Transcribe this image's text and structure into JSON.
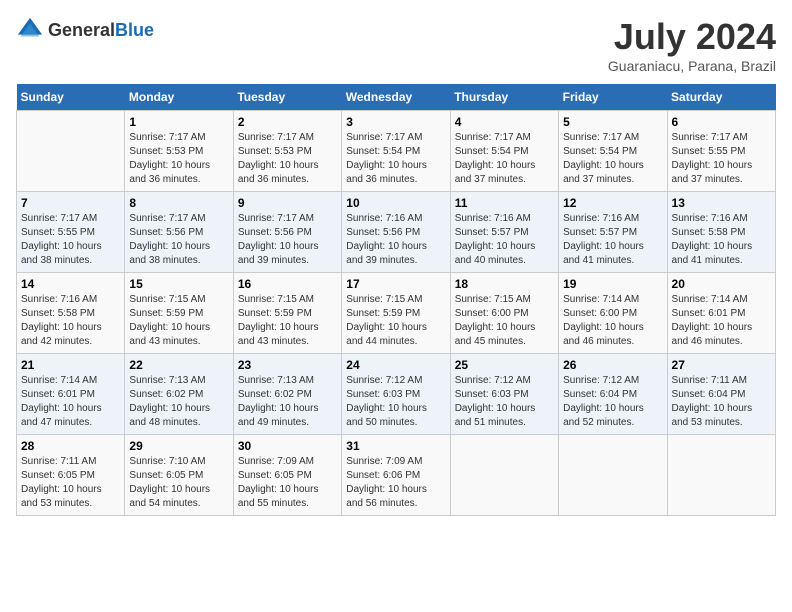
{
  "header": {
    "logo_general": "General",
    "logo_blue": "Blue",
    "title": "July 2024",
    "location": "Guaraniacu, Parana, Brazil"
  },
  "days_of_week": [
    "Sunday",
    "Monday",
    "Tuesday",
    "Wednesday",
    "Thursday",
    "Friday",
    "Saturday"
  ],
  "weeks": [
    [
      {
        "day": "",
        "info": ""
      },
      {
        "day": "1",
        "info": "Sunrise: 7:17 AM\nSunset: 5:53 PM\nDaylight: 10 hours\nand 36 minutes."
      },
      {
        "day": "2",
        "info": "Sunrise: 7:17 AM\nSunset: 5:53 PM\nDaylight: 10 hours\nand 36 minutes."
      },
      {
        "day": "3",
        "info": "Sunrise: 7:17 AM\nSunset: 5:54 PM\nDaylight: 10 hours\nand 36 minutes."
      },
      {
        "day": "4",
        "info": "Sunrise: 7:17 AM\nSunset: 5:54 PM\nDaylight: 10 hours\nand 37 minutes."
      },
      {
        "day": "5",
        "info": "Sunrise: 7:17 AM\nSunset: 5:54 PM\nDaylight: 10 hours\nand 37 minutes."
      },
      {
        "day": "6",
        "info": "Sunrise: 7:17 AM\nSunset: 5:55 PM\nDaylight: 10 hours\nand 37 minutes."
      }
    ],
    [
      {
        "day": "7",
        "info": "Sunrise: 7:17 AM\nSunset: 5:55 PM\nDaylight: 10 hours\nand 38 minutes."
      },
      {
        "day": "8",
        "info": "Sunrise: 7:17 AM\nSunset: 5:56 PM\nDaylight: 10 hours\nand 38 minutes."
      },
      {
        "day": "9",
        "info": "Sunrise: 7:17 AM\nSunset: 5:56 PM\nDaylight: 10 hours\nand 39 minutes."
      },
      {
        "day": "10",
        "info": "Sunrise: 7:16 AM\nSunset: 5:56 PM\nDaylight: 10 hours\nand 39 minutes."
      },
      {
        "day": "11",
        "info": "Sunrise: 7:16 AM\nSunset: 5:57 PM\nDaylight: 10 hours\nand 40 minutes."
      },
      {
        "day": "12",
        "info": "Sunrise: 7:16 AM\nSunset: 5:57 PM\nDaylight: 10 hours\nand 41 minutes."
      },
      {
        "day": "13",
        "info": "Sunrise: 7:16 AM\nSunset: 5:58 PM\nDaylight: 10 hours\nand 41 minutes."
      }
    ],
    [
      {
        "day": "14",
        "info": "Sunrise: 7:16 AM\nSunset: 5:58 PM\nDaylight: 10 hours\nand 42 minutes."
      },
      {
        "day": "15",
        "info": "Sunrise: 7:15 AM\nSunset: 5:59 PM\nDaylight: 10 hours\nand 43 minutes."
      },
      {
        "day": "16",
        "info": "Sunrise: 7:15 AM\nSunset: 5:59 PM\nDaylight: 10 hours\nand 43 minutes."
      },
      {
        "day": "17",
        "info": "Sunrise: 7:15 AM\nSunset: 5:59 PM\nDaylight: 10 hours\nand 44 minutes."
      },
      {
        "day": "18",
        "info": "Sunrise: 7:15 AM\nSunset: 6:00 PM\nDaylight: 10 hours\nand 45 minutes."
      },
      {
        "day": "19",
        "info": "Sunrise: 7:14 AM\nSunset: 6:00 PM\nDaylight: 10 hours\nand 46 minutes."
      },
      {
        "day": "20",
        "info": "Sunrise: 7:14 AM\nSunset: 6:01 PM\nDaylight: 10 hours\nand 46 minutes."
      }
    ],
    [
      {
        "day": "21",
        "info": "Sunrise: 7:14 AM\nSunset: 6:01 PM\nDaylight: 10 hours\nand 47 minutes."
      },
      {
        "day": "22",
        "info": "Sunrise: 7:13 AM\nSunset: 6:02 PM\nDaylight: 10 hours\nand 48 minutes."
      },
      {
        "day": "23",
        "info": "Sunrise: 7:13 AM\nSunset: 6:02 PM\nDaylight: 10 hours\nand 49 minutes."
      },
      {
        "day": "24",
        "info": "Sunrise: 7:12 AM\nSunset: 6:03 PM\nDaylight: 10 hours\nand 50 minutes."
      },
      {
        "day": "25",
        "info": "Sunrise: 7:12 AM\nSunset: 6:03 PM\nDaylight: 10 hours\nand 51 minutes."
      },
      {
        "day": "26",
        "info": "Sunrise: 7:12 AM\nSunset: 6:04 PM\nDaylight: 10 hours\nand 52 minutes."
      },
      {
        "day": "27",
        "info": "Sunrise: 7:11 AM\nSunset: 6:04 PM\nDaylight: 10 hours\nand 53 minutes."
      }
    ],
    [
      {
        "day": "28",
        "info": "Sunrise: 7:11 AM\nSunset: 6:05 PM\nDaylight: 10 hours\nand 53 minutes."
      },
      {
        "day": "29",
        "info": "Sunrise: 7:10 AM\nSunset: 6:05 PM\nDaylight: 10 hours\nand 54 minutes."
      },
      {
        "day": "30",
        "info": "Sunrise: 7:09 AM\nSunset: 6:05 PM\nDaylight: 10 hours\nand 55 minutes."
      },
      {
        "day": "31",
        "info": "Sunrise: 7:09 AM\nSunset: 6:06 PM\nDaylight: 10 hours\nand 56 minutes."
      },
      {
        "day": "",
        "info": ""
      },
      {
        "day": "",
        "info": ""
      },
      {
        "day": "",
        "info": ""
      }
    ]
  ]
}
